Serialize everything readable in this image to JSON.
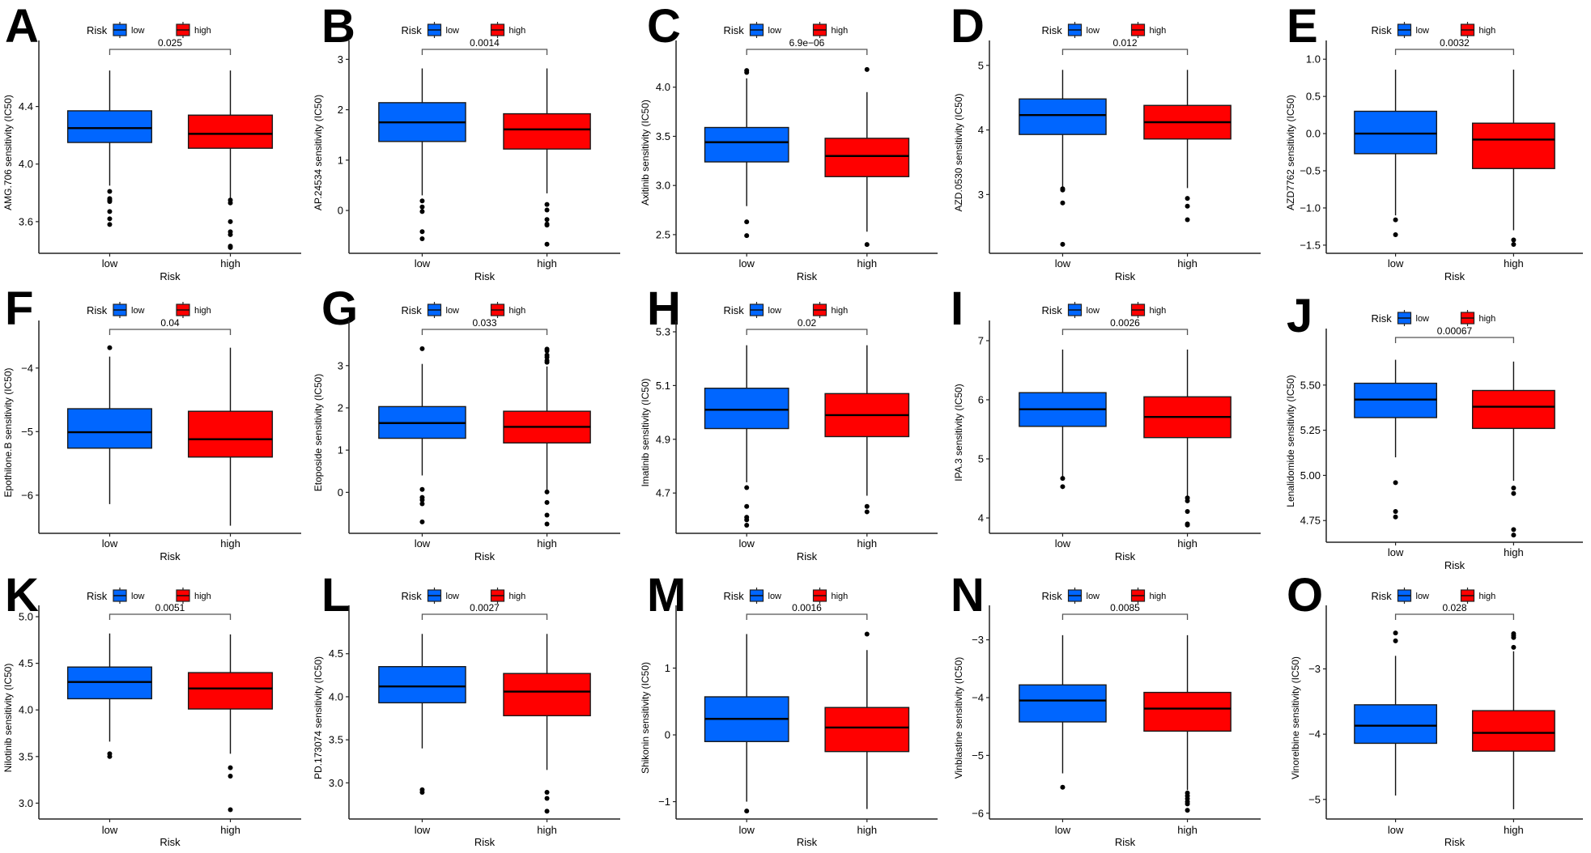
{
  "figure": {
    "colors": {
      "low": "#0066FF",
      "high": "#FF0000",
      "outline": "#1a1a1a",
      "bracket": "#555555"
    }
  },
  "chart_data": [
    {
      "panel": "A",
      "type": "box",
      "title": "",
      "legend": {
        "title": "Risk",
        "entries": [
          "low",
          "high"
        ],
        "position": "top"
      },
      "xlabel": "Risk",
      "ylabel": "AMG.706 sensitivity (IC50)",
      "categories": [
        "low",
        "high"
      ],
      "yticks": [
        3.6,
        4.0,
        4.4
      ],
      "ytick_labels": [
        "3.6",
        "4.0",
        "4.4"
      ],
      "ylim": [
        3.38,
        4.78
      ],
      "p_value": "0.025",
      "series": [
        {
          "name": "low",
          "whisker_high": 4.65,
          "q3": 4.37,
          "median": 4.25,
          "q1": 4.15,
          "whisker_low": 3.85,
          "outliers": [
            3.81,
            3.76,
            3.75,
            3.74,
            3.67,
            3.62,
            3.58
          ]
        },
        {
          "name": "high",
          "whisker_high": 4.65,
          "q3": 4.34,
          "median": 4.21,
          "q1": 4.11,
          "whisker_low": 3.76,
          "outliers": [
            3.75,
            3.73,
            3.6,
            3.53,
            3.51,
            3.43,
            3.42
          ]
        }
      ]
    },
    {
      "panel": "B",
      "type": "box",
      "legend": {
        "title": "Risk",
        "entries": [
          "low",
          "high"
        ],
        "position": "top"
      },
      "xlabel": "Risk",
      "ylabel": "AP.24534 sensitivity (IC50)",
      "categories": [
        "low",
        "high"
      ],
      "yticks": [
        0,
        1,
        2,
        3
      ],
      "ytick_labels": [
        "0",
        "1",
        "2",
        "3"
      ],
      "ylim": [
        -0.85,
        3.15
      ],
      "p_value": "0.0014",
      "series": [
        {
          "name": "low",
          "whisker_high": 2.82,
          "q3": 2.14,
          "median": 1.75,
          "q1": 1.37,
          "whisker_low": 0.3,
          "outliers": [
            0.19,
            0.07,
            -0.02,
            -0.42,
            -0.56
          ]
        },
        {
          "name": "high",
          "whisker_high": 2.82,
          "q3": 1.92,
          "median": 1.61,
          "q1": 1.22,
          "whisker_low": 0.34,
          "outliers": [
            0.12,
            0.01,
            -0.18,
            -0.27,
            -0.29,
            -0.67
          ]
        }
      ]
    },
    {
      "panel": "C",
      "type": "box",
      "legend": {
        "title": "Risk",
        "entries": [
          "low",
          "high"
        ],
        "position": "top"
      },
      "xlabel": "Risk",
      "ylabel": "Axitinib sensitivity (IC50)",
      "categories": [
        "low",
        "high"
      ],
      "yticks": [
        2.5,
        3.0,
        3.5,
        4.0
      ],
      "ytick_labels": [
        "2.5",
        "3.0",
        "3.5",
        "4.0"
      ],
      "ylim": [
        2.31,
        4.36
      ],
      "p_value": "6.9e−06",
      "series": [
        {
          "name": "low",
          "whisker_high": 4.09,
          "q3": 3.59,
          "median": 3.44,
          "q1": 3.24,
          "whisker_low": 2.79,
          "outliers": [
            4.17,
            4.15,
            2.63,
            2.49
          ]
        },
        {
          "name": "high",
          "whisker_high": 3.95,
          "q3": 3.48,
          "median": 3.3,
          "q1": 3.09,
          "whisker_low": 2.53,
          "outliers": [
            4.18,
            2.4
          ]
        }
      ]
    },
    {
      "panel": "D",
      "type": "box",
      "legend": {
        "title": "Risk",
        "entries": [
          "low",
          "high"
        ],
        "position": "top"
      },
      "xlabel": "Risk",
      "ylabel": "AZD.0530 sensitivity (IC50)",
      "categories": [
        "low",
        "high"
      ],
      "yticks": [
        3,
        4,
        5
      ],
      "ytick_labels": [
        "3",
        "4",
        "5"
      ],
      "ylim": [
        2.09,
        5.21
      ],
      "p_value": "0.012",
      "series": [
        {
          "name": "low",
          "whisker_high": 4.93,
          "q3": 4.48,
          "median": 4.23,
          "q1": 3.93,
          "whisker_low": 3.12,
          "outliers": [
            3.09,
            3.07,
            2.87,
            2.23
          ]
        },
        {
          "name": "high",
          "whisker_high": 4.93,
          "q3": 4.38,
          "median": 4.12,
          "q1": 3.86,
          "whisker_low": 3.1,
          "outliers": [
            2.94,
            2.82,
            2.61
          ]
        }
      ]
    },
    {
      "panel": "E",
      "type": "box",
      "legend": {
        "title": "Risk",
        "entries": [
          "low",
          "high"
        ],
        "position": "top"
      },
      "xlabel": "Risk",
      "ylabel": "AZD7762 sensitivity (IC50)",
      "categories": [
        "low",
        "high"
      ],
      "yticks": [
        -1.5,
        -1.0,
        -0.5,
        0.0,
        0.5,
        1.0
      ],
      "ytick_labels": [
        "−1.5",
        "−1.0",
        "−0.5",
        "0.0",
        "0.5",
        "1.0"
      ],
      "ylim": [
        -1.61,
        1.1
      ],
      "p_value": "0.0032",
      "series": [
        {
          "name": "low",
          "whisker_high": 0.86,
          "q3": 0.3,
          "median": 0.0,
          "q1": -0.27,
          "whisker_low": -1.1,
          "outliers": [
            -1.16,
            -1.36
          ]
        },
        {
          "name": "high",
          "whisker_high": 0.86,
          "q3": 0.14,
          "median": -0.08,
          "q1": -0.47,
          "whisker_low": -1.3,
          "outliers": [
            -1.43,
            -1.49
          ]
        }
      ]
    },
    {
      "panel": "F",
      "type": "box",
      "legend": {
        "title": "Risk",
        "entries": [
          "low",
          "high"
        ],
        "position": "top"
      },
      "xlabel": "Risk",
      "ylabel": "Epothilone.B sensitivity (IC50)",
      "categories": [
        "low",
        "high"
      ],
      "yticks": [
        -6,
        -5,
        -4
      ],
      "ytick_labels": [
        "−6",
        "−5",
        "−4"
      ],
      "ylim": [
        -6.6,
        -3.43
      ],
      "p_value": "0.04",
      "series": [
        {
          "name": "low",
          "whisker_high": -3.82,
          "q3": -4.64,
          "median": -5.01,
          "q1": -5.26,
          "whisker_low": -6.14,
          "outliers": [
            -3.68
          ]
        },
        {
          "name": "high",
          "whisker_high": -3.68,
          "q3": -4.68,
          "median": -5.12,
          "q1": -5.4,
          "whisker_low": -6.48,
          "outliers": []
        }
      ]
    },
    {
      "panel": "G",
      "type": "box",
      "legend": {
        "title": "Risk",
        "entries": [
          "low",
          "high"
        ],
        "position": "top"
      },
      "xlabel": "Risk",
      "ylabel": "Etoposide sensitivity (IC50)",
      "categories": [
        "low",
        "high"
      ],
      "yticks": [
        0,
        1,
        2,
        3
      ],
      "ytick_labels": [
        "0",
        "1",
        "2",
        "3"
      ],
      "ylim": [
        -0.97,
        3.8
      ],
      "p_value": "0.033",
      "series": [
        {
          "name": "low",
          "whisker_high": 3.04,
          "q3": 2.03,
          "median": 1.64,
          "q1": 1.28,
          "whisker_low": 0.4,
          "outliers": [
            3.4,
            0.07,
            -0.12,
            -0.18,
            -0.27,
            -0.7
          ]
        },
        {
          "name": "high",
          "whisker_high": 2.98,
          "q3": 1.92,
          "median": 1.55,
          "q1": 1.17,
          "whisker_low": 0.05,
          "outliers": [
            3.39,
            3.35,
            3.25,
            3.2,
            3.12,
            3.08,
            0.01,
            -0.24,
            -0.54,
            -0.75
          ]
        }
      ]
    },
    {
      "panel": "H",
      "type": "box",
      "legend": {
        "title": "Risk",
        "entries": [
          "low",
          "high"
        ],
        "position": "top"
      },
      "xlabel": "Risk",
      "ylabel": "Imatinib sensitivity (IC50)",
      "categories": [
        "low",
        "high"
      ],
      "yticks": [
        4.7,
        4.9,
        5.1,
        5.3
      ],
      "ytick_labels": [
        "4.7",
        "4.9",
        "5.1",
        "5.3"
      ],
      "ylim": [
        4.55,
        5.3
      ],
      "p_value": "0.02",
      "series": [
        {
          "name": "low",
          "whisker_high": 5.25,
          "q3": 5.09,
          "median": 5.01,
          "q1": 4.94,
          "whisker_low": 4.74,
          "outliers": [
            4.72,
            4.65,
            4.61,
            4.6,
            4.58
          ]
        },
        {
          "name": "high",
          "whisker_high": 5.25,
          "q3": 5.07,
          "median": 4.99,
          "q1": 4.91,
          "whisker_low": 4.69,
          "outliers": [
            4.65,
            4.63
          ]
        }
      ]
    },
    {
      "panel": "I",
      "type": "box",
      "legend": {
        "title": "Risk",
        "entries": [
          "low",
          "high"
        ],
        "position": "top"
      },
      "xlabel": "Risk",
      "ylabel": "IPA.3 sensitivity (IC50)",
      "categories": [
        "low",
        "high"
      ],
      "yticks": [
        4,
        5,
        6,
        7
      ],
      "ytick_labels": [
        "4",
        "5",
        "6",
        "7"
      ],
      "ylim": [
        3.74,
        7.15
      ],
      "p_value": "0.0026",
      "series": [
        {
          "name": "low",
          "whisker_high": 6.85,
          "q3": 6.12,
          "median": 5.84,
          "q1": 5.55,
          "whisker_low": 4.7,
          "outliers": [
            4.67,
            4.53
          ]
        },
        {
          "name": "high",
          "whisker_high": 6.85,
          "q3": 6.05,
          "median": 5.71,
          "q1": 5.36,
          "whisker_low": 4.35,
          "outliers": [
            4.34,
            4.29,
            4.11,
            3.9,
            3.88
          ]
        }
      ]
    },
    {
      "panel": "J",
      "type": "box",
      "legend": {
        "title": "Risk",
        "entries": [
          "low",
          "high"
        ],
        "position": "top"
      },
      "xlabel": "Risk",
      "ylabel": "Lenalidomide sensitivity (IC50)",
      "categories": [
        "low",
        "high"
      ],
      "yticks": [
        4.75,
        5.0,
        5.25,
        5.5
      ],
      "ytick_labels": [
        "4.75",
        "5.00",
        "5.25",
        "5.50"
      ],
      "ylim": [
        4.63,
        5.75
      ],
      "p_value": "0.00067",
      "series": [
        {
          "name": "low",
          "whisker_high": 5.64,
          "q3": 5.51,
          "median": 5.42,
          "q1": 5.32,
          "whisker_low": 5.1,
          "outliers": [
            4.96,
            4.8,
            4.77
          ]
        },
        {
          "name": "high",
          "whisker_high": 5.63,
          "q3": 5.47,
          "median": 5.38,
          "q1": 5.26,
          "whisker_low": 4.97,
          "outliers": [
            4.93,
            4.9,
            4.7,
            4.67
          ]
        }
      ]
    },
    {
      "panel": "K",
      "type": "box",
      "legend": {
        "title": "Risk",
        "entries": [
          "low",
          "high"
        ],
        "position": "top"
      },
      "xlabel": "Risk",
      "ylabel": "Nilotinib sensitivity (IC50)",
      "categories": [
        "low",
        "high"
      ],
      "yticks": [
        3.0,
        3.5,
        4.0,
        4.5,
        5.0
      ],
      "ytick_labels": [
        "3.0",
        "3.5",
        "4.0",
        "4.5",
        "5.0"
      ],
      "ylim": [
        2.83,
        5.0
      ],
      "p_value": "0.0051",
      "series": [
        {
          "name": "low",
          "whisker_high": 4.82,
          "q3": 4.46,
          "median": 4.3,
          "q1": 4.12,
          "whisker_low": 3.66,
          "outliers": [
            3.53,
            3.5
          ]
        },
        {
          "name": "high",
          "whisker_high": 4.81,
          "q3": 4.4,
          "median": 4.23,
          "q1": 4.01,
          "whisker_low": 3.53,
          "outliers": [
            3.38,
            3.29,
            2.93
          ]
        }
      ]
    },
    {
      "panel": "L",
      "type": "box",
      "legend": {
        "title": "Risk",
        "entries": [
          "low",
          "high"
        ],
        "position": "top"
      },
      "xlabel": "Risk",
      "ylabel": "PD.173074 sensitivity (IC50)",
      "categories": [
        "low",
        "high"
      ],
      "yticks": [
        3.0,
        3.5,
        4.0,
        4.5
      ],
      "ytick_labels": [
        "3.0",
        "3.5",
        "4.0",
        "4.5"
      ],
      "ylim": [
        2.58,
        4.93
      ],
      "p_value": "0.0027",
      "series": [
        {
          "name": "low",
          "whisker_high": 4.73,
          "q3": 4.35,
          "median": 4.12,
          "q1": 3.93,
          "whisker_low": 3.4,
          "outliers": [
            2.92,
            2.89
          ]
        },
        {
          "name": "high",
          "whisker_high": 4.73,
          "q3": 4.27,
          "median": 4.06,
          "q1": 3.78,
          "whisker_low": 3.15,
          "outliers": [
            2.89,
            2.82,
            2.67
          ]
        }
      ]
    },
    {
      "panel": "M",
      "type": "box",
      "legend": {
        "title": "Risk",
        "entries": [
          "low",
          "high"
        ],
        "position": "top"
      },
      "xlabel": "Risk",
      "ylabel": "Shikonin sensitivity (IC50)",
      "categories": [
        "low",
        "high"
      ],
      "yticks": [
        -1,
        0,
        1
      ],
      "ytick_labels": [
        "−1",
        "0",
        "1"
      ],
      "ylim": [
        -1.26,
        1.77
      ],
      "p_value": "0.0016",
      "series": [
        {
          "name": "low",
          "whisker_high": 1.51,
          "q3": 0.57,
          "median": 0.24,
          "q1": -0.1,
          "whisker_low": -1.0,
          "outliers": [
            -1.14
          ]
        },
        {
          "name": "high",
          "whisker_high": 1.27,
          "q3": 0.41,
          "median": 0.11,
          "q1": -0.25,
          "whisker_low": -1.11,
          "outliers": [
            1.51
          ]
        }
      ]
    },
    {
      "panel": "N",
      "type": "box",
      "legend": {
        "title": "Risk",
        "entries": [
          "low",
          "high"
        ],
        "position": "top"
      },
      "xlabel": "Risk",
      "ylabel": "Vinblastine sensitivity (IC50)",
      "categories": [
        "low",
        "high"
      ],
      "yticks": [
        -6,
        -5,
        -4,
        -3
      ],
      "ytick_labels": [
        "−6",
        "−5",
        "−4",
        "−3"
      ],
      "ylim": [
        -6.1,
        -2.6
      ],
      "p_value": "0.0085",
      "series": [
        {
          "name": "low",
          "whisker_high": -2.92,
          "q3": -3.78,
          "median": -4.05,
          "q1": -4.42,
          "whisker_low": -5.31,
          "outliers": [
            -5.55
          ]
        },
        {
          "name": "high",
          "whisker_high": -2.92,
          "q3": -3.91,
          "median": -4.19,
          "q1": -4.58,
          "whisker_low": -5.6,
          "outliers": [
            -5.65,
            -5.7,
            -5.75,
            -5.8,
            -5.84,
            -5.95
          ]
        }
      ]
    },
    {
      "panel": "O",
      "type": "box",
      "legend": {
        "title": "Risk",
        "entries": [
          "low",
          "high"
        ],
        "position": "top"
      },
      "xlabel": "Risk",
      "ylabel": "Vinorelbine sensitivity (IC50)",
      "categories": [
        "low",
        "high"
      ],
      "yticks": [
        -5,
        -4,
        -3
      ],
      "ytick_labels": [
        "−5",
        "−4",
        "−3"
      ],
      "ylim": [
        -5.3,
        -2.2
      ],
      "p_value": "0.028",
      "series": [
        {
          "name": "low",
          "whisker_high": -2.8,
          "q3": -3.55,
          "median": -3.87,
          "q1": -4.14,
          "whisker_low": -4.94,
          "outliers": [
            -2.45,
            -2.57
          ]
        },
        {
          "name": "high",
          "whisker_high": -2.73,
          "q3": -3.64,
          "median": -3.98,
          "q1": -4.26,
          "whisker_low": -5.15,
          "outliers": [
            -2.46,
            -2.49,
            -2.52,
            -2.67
          ]
        }
      ]
    }
  ]
}
